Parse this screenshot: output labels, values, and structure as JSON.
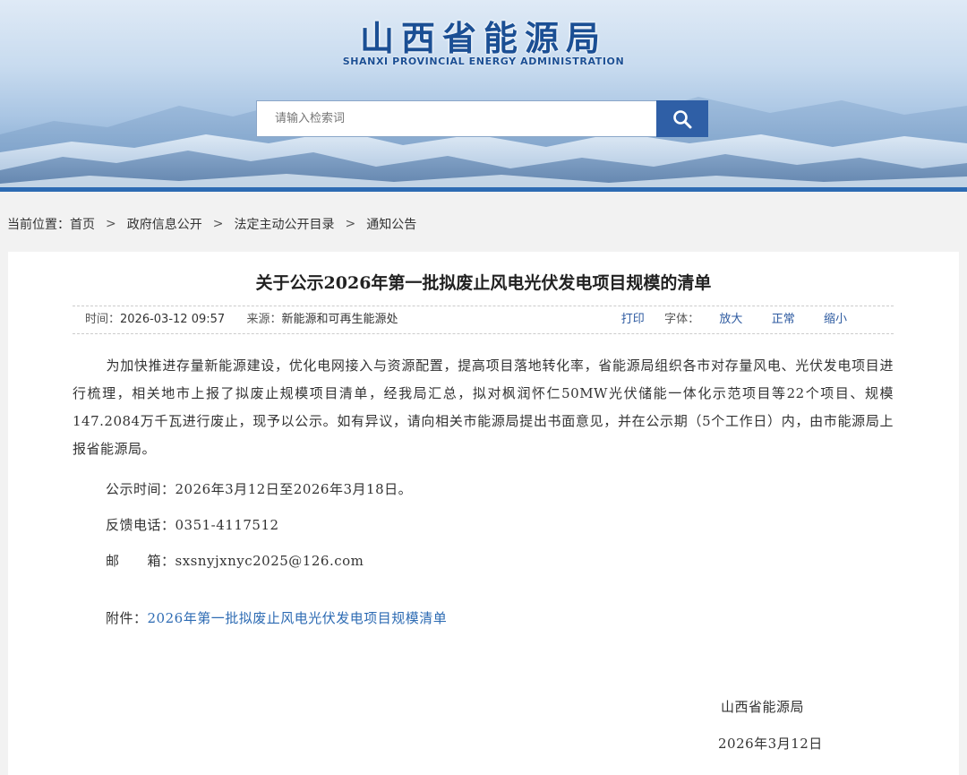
{
  "header": {
    "title": "山西省能源局",
    "subtitle": "SHANXI PROVINCIAL ENERGY ADMINISTRATION",
    "search_placeholder": "请输入检索词"
  },
  "breadcrumb": {
    "prefix": "当前位置：",
    "items": [
      "首页",
      "政府信息公开",
      "法定主动公开目录",
      "通知公告"
    ],
    "separator": ">"
  },
  "article": {
    "title": "关于公示2026年第一批拟废止风电光伏发电项目规模的清单",
    "meta": {
      "time_label": "时间：",
      "time_value": "2026-03-12 09:57",
      "source_label": "来源：",
      "source_value": "新能源和可再生能源处",
      "print": "打印",
      "font_label": "字体：",
      "font_large": "放大",
      "font_normal": "正常",
      "font_small": "缩小"
    },
    "paragraph": "为加快推进存量新能源建设，优化电网接入与资源配置，提高项目落地转化率，省能源局组织各市对存量风电、光伏发电项目进行梳理，相关地市上报了拟废止规模项目清单，经我局汇总，拟对枫润怀仁50MW光伏储能一体化示范项目等22个项目、规模147.2084万千瓦进行废止，现予以公示。如有异议，请向相关市能源局提出书面意见，并在公示期（5个工作日）内，由市能源局上报省能源局。",
    "period": "公示时间：2026年3月12日至2026年3月18日。",
    "phone": "反馈电话：0351-4117512",
    "email": "邮　　箱：sxsnyjxnyc2025@126.com",
    "attachment_label": "附件：",
    "attachment_link": "2026年第一批拟废止风电光伏发电项目规模清单",
    "signature": "山西省能源局",
    "date": "2026年3月12日"
  },
  "colors": {
    "brand": "#1b4f94",
    "search_button": "#2f5fa6",
    "link": "#2d6bb3"
  }
}
